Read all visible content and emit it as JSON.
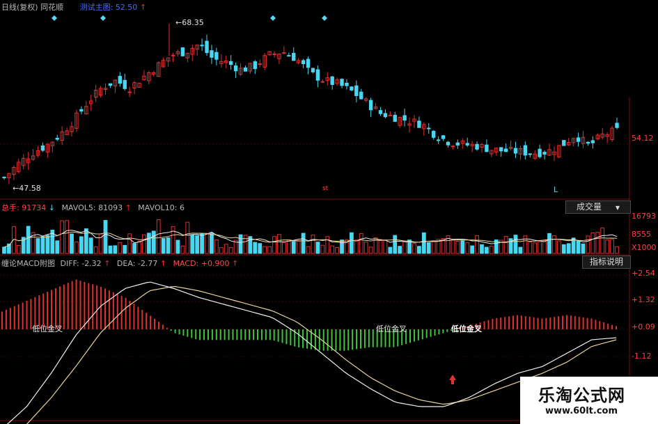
{
  "main_header": {
    "period": "日线(复权)",
    "app_name": "同花顺",
    "indicator": "测试主图:",
    "indicator_value": "52.50",
    "indicator_arrow": "↑"
  },
  "main_labels": {
    "high_label": "68.35",
    "low_label": "47.58",
    "right_price": "54.12",
    "center_mark": "st",
    "l_mark": "L"
  },
  "vol_header": {
    "total": "总手:",
    "total_value": "91734",
    "total_arrow": "↓",
    "mavol5": "MAVOL5:",
    "mavol5_value": "81093",
    "mavol5_arrow": "↑",
    "mavol10": "MAVOL10:",
    "mavol10_value": "6"
  },
  "vol_axis": [
    "16793",
    "8555",
    "X1000"
  ],
  "vol_button": "成交量",
  "macd_header": {
    "name": "缠论MACD附图",
    "diff": "DIFF:",
    "diff_value": "-2.32",
    "diff_arrow": "↑",
    "dea": "DEA:",
    "dea_value": "-2.77",
    "dea_arrow": "↑",
    "macd": "MACD:",
    "macd_value": "+0.900",
    "macd_arrow": "↑"
  },
  "macd_button": "指标说明",
  "macd_axis": [
    "+2.54",
    "+1.32",
    "+0.09",
    "-1.12"
  ],
  "macd_annotations": [
    "低位金叉",
    "低位金叉",
    "低位金叉"
  ],
  "watermark": {
    "title": "乐淘公式网",
    "url": "www.60lt.com"
  },
  "colors": {
    "up": "#e03030",
    "down": "#49d6f0",
    "macd_pos": "#e03030",
    "macd_neg": "#3ec43e",
    "diff_line": "#f0f0f0",
    "dea_line": "#e8d49a",
    "panel_grid": "#7a1010"
  },
  "chart_data": [
    {
      "type": "candlestick",
      "title": "测试主图",
      "annotations": [
        "68.35",
        "47.58"
      ],
      "price_label": "54.12",
      "close_trace": [
        47.6,
        49.5,
        51,
        52,
        53.5,
        55.5,
        58,
        60,
        61,
        60,
        61.5,
        63,
        64.5,
        65,
        66,
        64,
        63.5,
        62.5,
        63,
        64.5,
        65,
        64,
        62,
        61,
        60.5,
        59.5,
        58,
        56.5,
        56,
        55.5,
        55,
        53.5,
        52.5,
        52.2,
        52,
        51.5,
        51.3,
        51.2,
        51,
        51.2,
        52,
        53.5,
        52,
        53.5,
        54.12
      ]
    },
    {
      "type": "bar",
      "title": "成交量",
      "series": [
        {
          "name": "总手",
          "values": [
            91734
          ]
        },
        {
          "name": "MAVOL5",
          "values": [
            81093
          ]
        }
      ],
      "axis_labels": [
        "16793",
        "8555",
        "X1000"
      ]
    },
    {
      "type": "line",
      "title": "缠论MACD附图",
      "axis_labels": [
        "+2.54",
        "+1.32",
        "+0.09",
        "-1.12"
      ],
      "series": [
        {
          "name": "DIFF",
          "last": -2.32,
          "values": [
            -4.0,
            -3.0,
            -1.5,
            0.2,
            1.5,
            2.3,
            2.6,
            2.3,
            1.9,
            1.6,
            1.3,
            1.0,
            0.3,
            -0.6,
            -1.5,
            -2.2,
            -2.8,
            -3.0,
            -3.0,
            -2.6,
            -2.0,
            -1.5,
            -1.2,
            -0.6,
            0.0,
            0.09
          ]
        },
        {
          "name": "DEA",
          "last": -2.77,
          "values": [
            -4.5,
            -3.8,
            -2.6,
            -1.2,
            0.3,
            1.4,
            2.2,
            2.4,
            2.2,
            1.9,
            1.6,
            1.3,
            0.8,
            0.0,
            -0.9,
            -1.7,
            -2.3,
            -2.7,
            -2.9,
            -2.7,
            -2.3,
            -1.9,
            -1.5,
            -1.0,
            -0.3,
            0.0
          ]
        },
        {
          "name": "MACD",
          "last": 0.9
        }
      ]
    }
  ]
}
